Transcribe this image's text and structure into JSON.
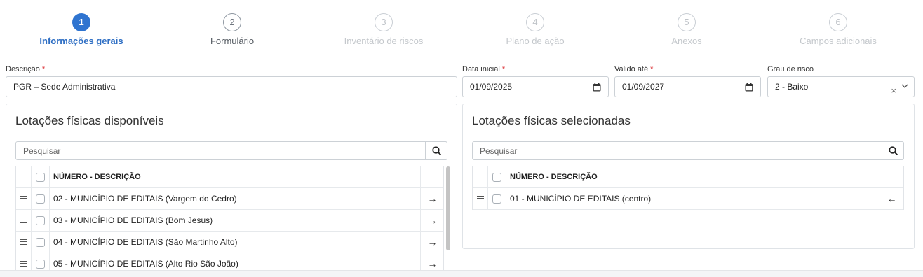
{
  "stepper": {
    "steps": [
      {
        "number": "1",
        "label": "Informações gerais"
      },
      {
        "number": "2",
        "label": "Formulário"
      },
      {
        "number": "3",
        "label": "Inventário de riscos"
      },
      {
        "number": "4",
        "label": "Plano de ação"
      },
      {
        "number": "5",
        "label": "Anexos"
      },
      {
        "number": "6",
        "label": "Campos adicionais"
      }
    ]
  },
  "form": {
    "descricao": {
      "label": "Descrição",
      "required": "*",
      "value": "PGR – Sede Administrativa"
    },
    "data_inicial": {
      "label": "Data inicial",
      "required": "*",
      "value": "01/09/2025"
    },
    "valido_ate": {
      "label": "Valido até",
      "required": "*",
      "value": "01/09/2027"
    },
    "grau_risco": {
      "label": "Grau de risco",
      "value": "2 - Baixo",
      "clear": "×"
    }
  },
  "available": {
    "title": "Lotações físicas disponíveis",
    "search_placeholder": "Pesquisar",
    "column_header": "NÚMERO - DESCRIÇÃO",
    "rows": [
      "02 - MUNICÍPIO DE EDITAIS (Vargem do Cedro)",
      "03 - MUNICÍPIO DE EDITAIS (Bom Jesus)",
      "04 - MUNICÍPIO DE EDITAIS (São Martinho Alto)",
      "05 - MUNICÍPIO DE EDITAIS (Alto Rio São João)"
    ],
    "row_action_icon": "arrow-right-icon"
  },
  "selected": {
    "title": "Lotações físicas selecionadas",
    "search_placeholder": "Pesquisar",
    "column_header": "NÚMERO - DESCRIÇÃO",
    "rows": [
      "01 - MUNICÍPIO DE EDITAIS (centro)"
    ],
    "row_action_icon": "arrow-left-icon"
  },
  "colors": {
    "accent": "#2f74d0",
    "required": "#d9262a",
    "border": "#ccd1d6"
  }
}
